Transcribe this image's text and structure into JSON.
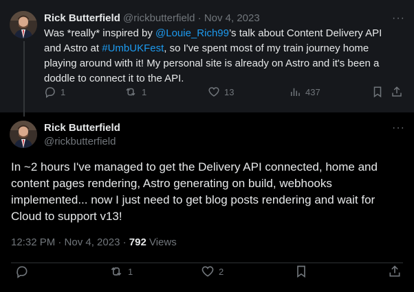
{
  "parent_tweet": {
    "author_name": "Rick Butterfield",
    "handle": "@rickbutterfield",
    "separator": "·",
    "date": "Nov 4, 2023",
    "text_parts": {
      "p1": "Was *really* inspired by ",
      "mention": "@Louie_Rich99",
      "p2": "’s talk about Content Delivery API and Astro at ",
      "hashtag": "#UmbUKFest",
      "p3": ", so I've spent most of my train journey home playing around with it! My personal site is already on Astro and it's been a doddle to connect it to the API."
    },
    "more_label": "···",
    "stats": {
      "replies": "1",
      "reposts": "1",
      "likes": "13",
      "views": "437"
    }
  },
  "main_tweet": {
    "author_name": "Rick Butterfield",
    "handle": "@rickbutterfield",
    "more_label": "···",
    "text": "In ~2 hours I've managed to get the Delivery API connected, home and content pages rendering, Astro generating on build, webhooks implemented... now I just need to get blog posts rendering and wait for Cloud to support v13!",
    "timestamp": "12:32 PM · Nov 4, 2023 · ",
    "view_count": "792",
    "views_label": " Views",
    "stats": {
      "reposts": "1",
      "likes": "2"
    }
  },
  "colors": {
    "background": "#000000",
    "parent_background": "#16181c",
    "text": "#e7e9ea",
    "muted": "#71767b",
    "link": "#1d9bf0"
  }
}
